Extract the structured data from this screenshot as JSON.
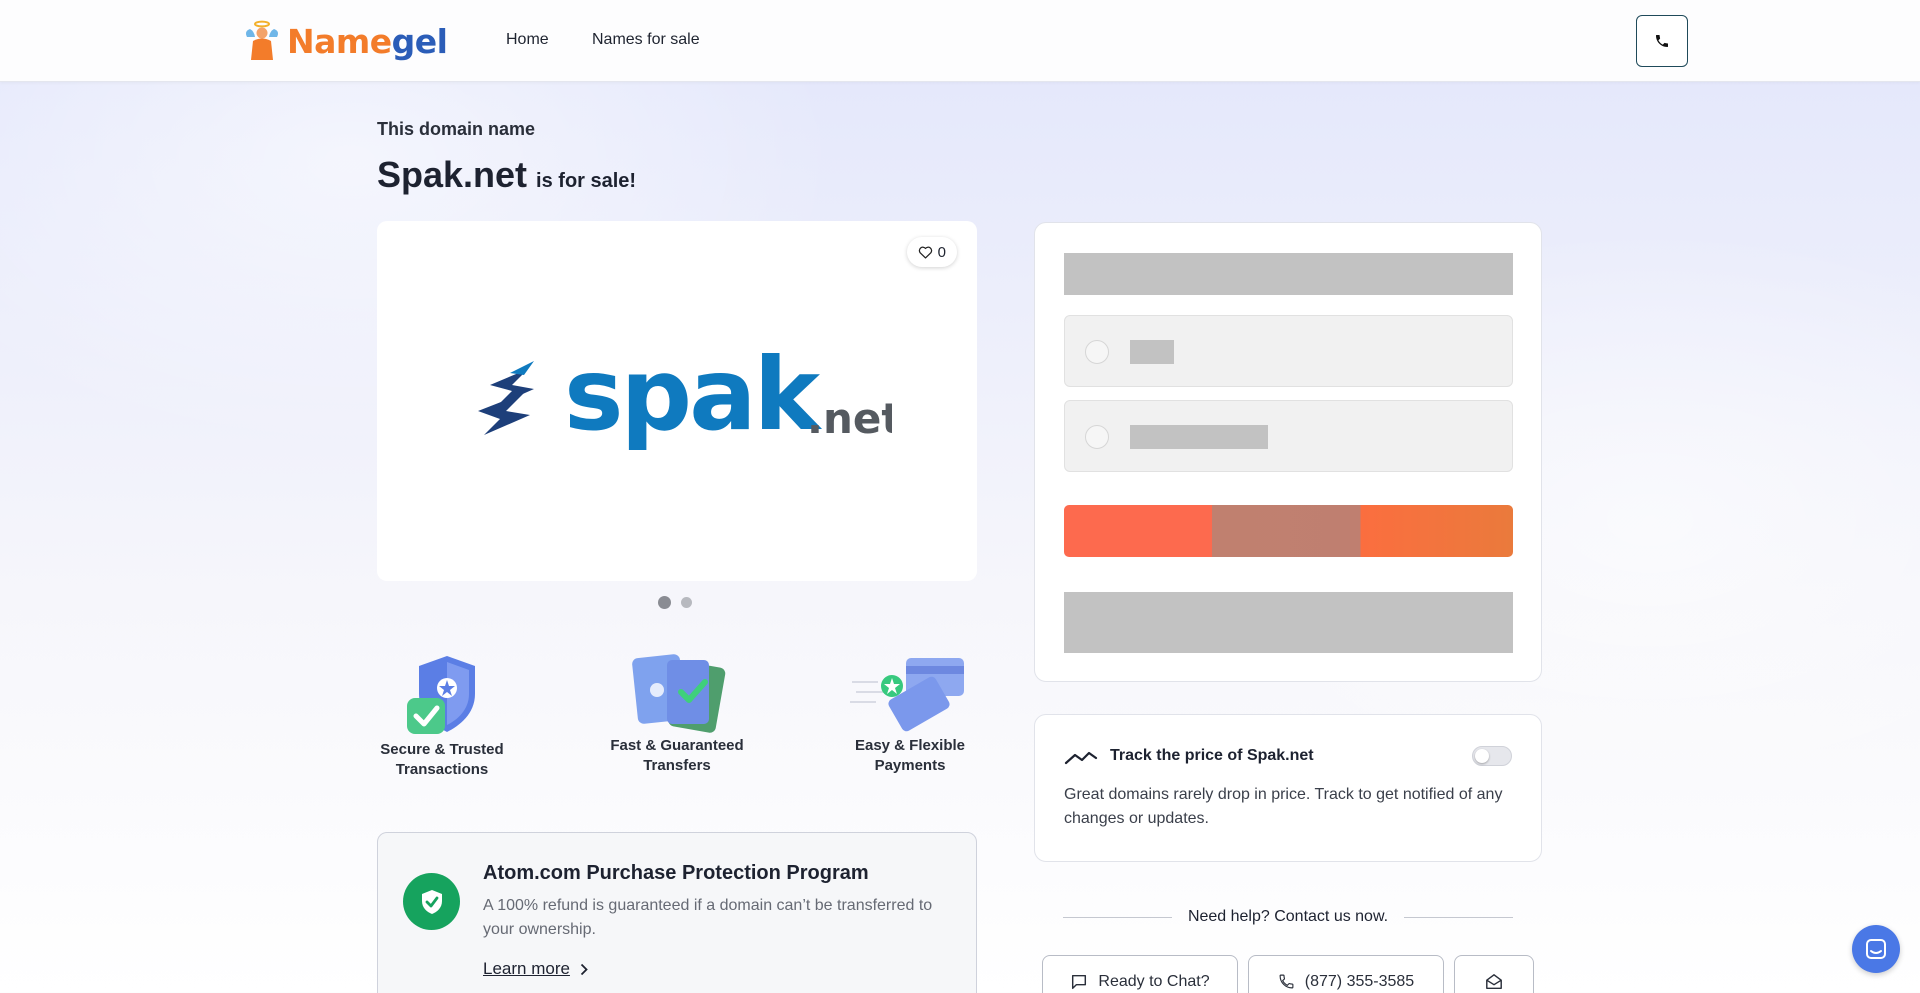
{
  "header": {
    "logo_part1": "Name",
    "logo_part2": "gel",
    "nav": {
      "home": "Home",
      "names_for_sale": "Names for sale"
    }
  },
  "hero": {
    "intro": "This domain name",
    "domain": "Spak.net",
    "suffix": "is for sale!"
  },
  "gallery": {
    "likes": "0",
    "logo_word": "spak",
    "logo_tld": ".net",
    "active_slide": 1,
    "slide_count": 2
  },
  "features": [
    {
      "line1": "Secure & Trusted",
      "line2": "Transactions"
    },
    {
      "line1": "Fast & Guaranteed",
      "line2": "Transfers"
    },
    {
      "line1": "Easy & Flexible",
      "line2": "Payments"
    }
  ],
  "protection": {
    "title": "Atom.com Purchase Protection Program",
    "text": "A 100% refund is guaranteed if a domain can’t be transferred to your ownership.",
    "link": "Learn more"
  },
  "tracker": {
    "title": "Track the price of Spak.net",
    "text": "Great domains rarely drop in price. Track to get notified of any changes or updates.",
    "enabled": false
  },
  "help": {
    "text": "Need help? Contact us now.",
    "chat": "Ready to Chat?",
    "phone": "(877) 355-3585"
  },
  "colors": {
    "brand_orange": "#f37c2a",
    "brand_blue": "#2b5db8",
    "spak_blue": "#0f7abf",
    "spak_dark": "#1d3f7a",
    "protect_green": "#16a35e",
    "buy_gradient_start": "#fd6a4e",
    "buy_gradient_end": "#ea7a3c",
    "chat_fab": "#4a78e6"
  }
}
